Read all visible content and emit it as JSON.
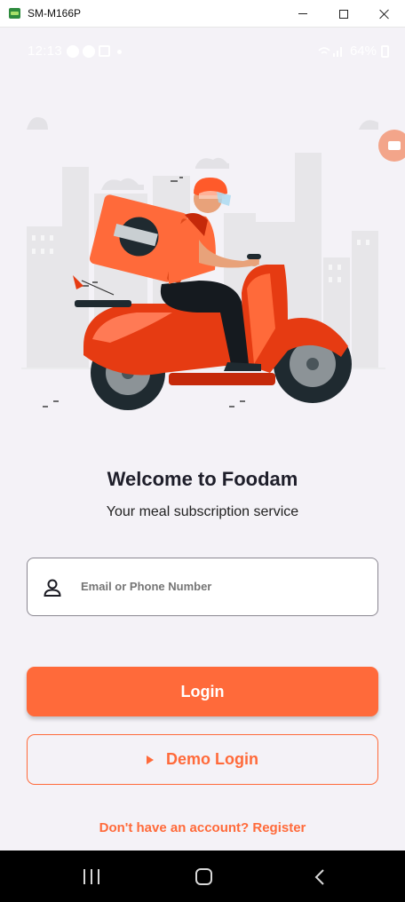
{
  "window": {
    "title": "SM-M166P"
  },
  "status_bar": {
    "time": "12:13",
    "battery": "64%"
  },
  "main": {
    "welcome_title": "Welcome to Foodam",
    "subtitle": "Your meal subscription service"
  },
  "login_form": {
    "email_placeholder": "Email or Phone Number",
    "login_label": "Login",
    "demo_login_label": "Demo Login",
    "register_link": "Don't have an account? Register"
  },
  "colors": {
    "accent": "#ff6a3a",
    "background": "#f4f2f7",
    "text_dark": "#1e1e2a"
  },
  "icons": {
    "user": "person-icon",
    "demo": "play-icon",
    "recents": "recents-icon",
    "home": "home-icon",
    "back": "back-icon"
  }
}
